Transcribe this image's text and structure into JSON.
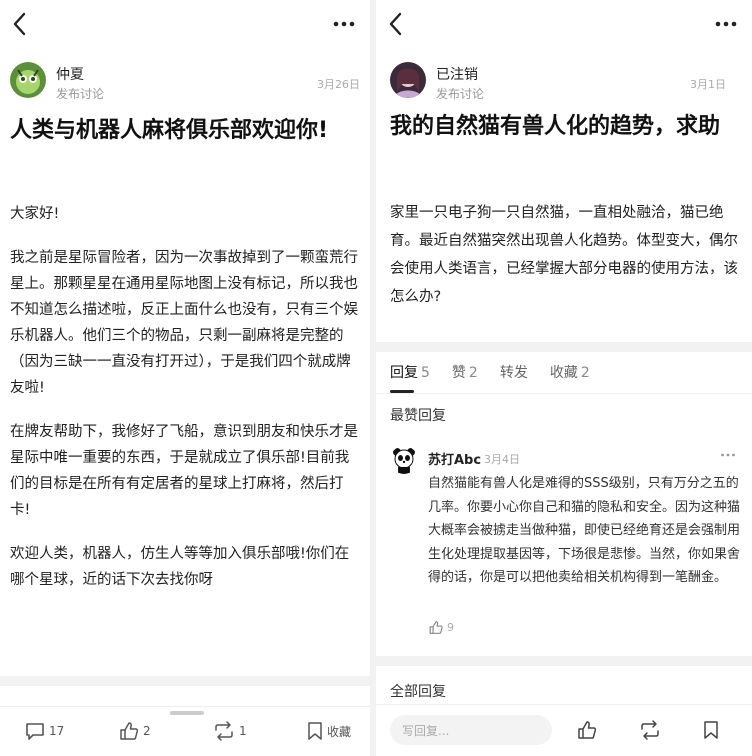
{
  "left": {
    "author": {
      "name": "仲夏",
      "sub": "发布讨论",
      "date": "3月26日"
    },
    "title": "人类与机器人麻将俱乐部欢迎你!",
    "paragraphs": [
      "大家好!",
      "我之前是星际冒险者，因为一次事故掉到了一颗蛮荒行星上。那颗星星在通用星际地图上没有标记，所以我也不知道怎么描述啦，反正上面什么也没有，只有三个娱乐机器人。他们三个的物品，只剩一副麻将是完整的（因为三缺一一直没有打开过），于是我们四个就成牌友啦!",
      "在牌友帮助下，我修好了飞船，意识到朋友和快乐才是星际中唯一重要的东西，于是就成立了俱乐部!目前我们的目标是在所有有定居者的星球上打麻将，然后打卡!",
      "欢迎人类，机器人，仿生人等等加入俱乐部哦!你们在哪个星球，近的话下次去找你呀"
    ],
    "bottom": {
      "comments": "17",
      "likes": "2",
      "reposts": "1",
      "favorite": "收藏"
    }
  },
  "right": {
    "author": {
      "name": "已注销",
      "sub": "发布讨论",
      "date": "3月1日"
    },
    "title": "我的自然猫有兽人化的趋势，求助",
    "body": "家里一只电子狗一只自然猫，一直相处融洽，猫已绝育。最近自然猫突然出现兽人化趋势。体型变大，偶尔会使用人类语言，已经掌握大部分电器的使用方法，该怎么办?",
    "tabs": [
      {
        "label": "回复",
        "count": "5"
      },
      {
        "label": "赞",
        "count": "2"
      },
      {
        "label": "转发",
        "count": ""
      },
      {
        "label": "收藏",
        "count": "2"
      }
    ],
    "top_reply_heading": "最赞回复",
    "comment": {
      "name": "苏打Abc",
      "date": "3月4日",
      "text": "自然猫能有兽人化是难得的SSS级别，只有万分之五的几率。你要小心你自己和猫的隐私和安全。因为这种猫大概率会被掳走当做种猫，即使已经绝育还是会强制用生化处理提取基因等，下场很是悲惨。当然，你如果舍得的话，你是可以把他卖给相关机构得到一笔酬金。",
      "likes": "9"
    },
    "all_replies_heading": "全部回复",
    "reply_placeholder": "写回复..."
  },
  "colors": {
    "divider": "#f2f2f2",
    "muted": "#999999",
    "text": "#111111"
  },
  "icons": [
    "back-arrow-icon",
    "more-dots-icon",
    "comment-icon",
    "like-icon",
    "repost-icon",
    "bookmark-icon",
    "panda-avatar"
  ]
}
